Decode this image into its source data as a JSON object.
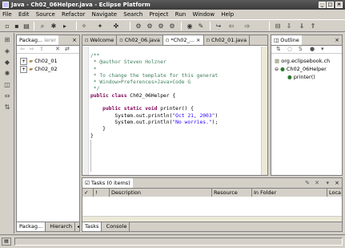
{
  "window": {
    "title": "Java - Ch02_06Helper.java - Eclipse Platform",
    "min": "_",
    "max": "□",
    "close": "×"
  },
  "menu": [
    "File",
    "Edit",
    "Source",
    "Refactor",
    "Navigate",
    "Search",
    "Project",
    "Run",
    "Window",
    "Help"
  ],
  "packages": {
    "tab_label": "Packag... ",
    "filter_placeholder": "ierer",
    "items": [
      {
        "expander": "+",
        "label": "Ch02_01"
      },
      {
        "expander": "+",
        "label": "Ch02_02"
      }
    ],
    "bottom_tabs": [
      "Packag...",
      "Hierarch"
    ]
  },
  "editor": {
    "tabs": [
      "Welcome",
      "Ch02_06.java",
      "*Ch02_...",
      "Ch02_01.java"
    ],
    "close_glyph": "×",
    "lines": [
      {
        "type": "comment",
        "text": "/**"
      },
      {
        "type": "comment",
        "text": " * @author Steven Holzner"
      },
      {
        "type": "comment",
        "text": " *"
      },
      {
        "type": "comment",
        "text": " * To change the template for this generat"
      },
      {
        "type": "comment",
        "text": " * Window&gt;Preferences&gt;Java&gt;Code G"
      },
      {
        "type": "comment",
        "text": " */"
      },
      {
        "type": "decl",
        "kw": "public class",
        "rest": " Ch02_06Helper {"
      },
      {
        "type": "blank",
        "text": ""
      },
      {
        "type": "decl",
        "kw": "    public static void",
        "rest": " printer() {"
      },
      {
        "type": "call",
        "pre": "        System.out.println(",
        "str": "\"Oct 21, 2003\"",
        "post": ")"
      },
      {
        "type": "call",
        "pre": "        System.out.println(",
        "str": "\"No worries.\"",
        "post": ");"
      },
      {
        "type": "plain",
        "text": "    }"
      },
      {
        "type": "plain",
        "text": "}"
      }
    ]
  },
  "outline": {
    "tab_label": "Outline",
    "items": [
      {
        "label": "org.eclipsebook.ch",
        "indent": 0
      },
      {
        "label": "Ch02_06Helper",
        "indent": 0
      },
      {
        "label": "printer()",
        "indent": 1
      }
    ]
  },
  "tasks": {
    "tab_label": "Tasks (0 items)",
    "columns": [
      "✓",
      "!",
      "Description",
      "Resource",
      "In Folder",
      "Loca"
    ],
    "bottom_tabs": [
      "Tasks",
      "Console"
    ]
  }
}
